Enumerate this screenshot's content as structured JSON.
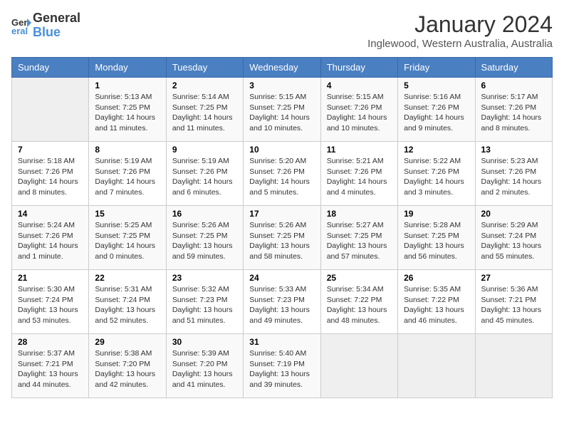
{
  "logo": {
    "line1": "General",
    "line2": "Blue"
  },
  "title": "January 2024",
  "location": "Inglewood, Western Australia, Australia",
  "days_of_week": [
    "Sunday",
    "Monday",
    "Tuesday",
    "Wednesday",
    "Thursday",
    "Friday",
    "Saturday"
  ],
  "weeks": [
    [
      {
        "day": "",
        "info": ""
      },
      {
        "day": "1",
        "info": "Sunrise: 5:13 AM\nSunset: 7:25 PM\nDaylight: 14 hours\nand 11 minutes."
      },
      {
        "day": "2",
        "info": "Sunrise: 5:14 AM\nSunset: 7:25 PM\nDaylight: 14 hours\nand 11 minutes."
      },
      {
        "day": "3",
        "info": "Sunrise: 5:15 AM\nSunset: 7:25 PM\nDaylight: 14 hours\nand 10 minutes."
      },
      {
        "day": "4",
        "info": "Sunrise: 5:15 AM\nSunset: 7:26 PM\nDaylight: 14 hours\nand 10 minutes."
      },
      {
        "day": "5",
        "info": "Sunrise: 5:16 AM\nSunset: 7:26 PM\nDaylight: 14 hours\nand 9 minutes."
      },
      {
        "day": "6",
        "info": "Sunrise: 5:17 AM\nSunset: 7:26 PM\nDaylight: 14 hours\nand 8 minutes."
      }
    ],
    [
      {
        "day": "7",
        "info": "Sunrise: 5:18 AM\nSunset: 7:26 PM\nDaylight: 14 hours\nand 8 minutes."
      },
      {
        "day": "8",
        "info": "Sunrise: 5:19 AM\nSunset: 7:26 PM\nDaylight: 14 hours\nand 7 minutes."
      },
      {
        "day": "9",
        "info": "Sunrise: 5:19 AM\nSunset: 7:26 PM\nDaylight: 14 hours\nand 6 minutes."
      },
      {
        "day": "10",
        "info": "Sunrise: 5:20 AM\nSunset: 7:26 PM\nDaylight: 14 hours\nand 5 minutes."
      },
      {
        "day": "11",
        "info": "Sunrise: 5:21 AM\nSunset: 7:26 PM\nDaylight: 14 hours\nand 4 minutes."
      },
      {
        "day": "12",
        "info": "Sunrise: 5:22 AM\nSunset: 7:26 PM\nDaylight: 14 hours\nand 3 minutes."
      },
      {
        "day": "13",
        "info": "Sunrise: 5:23 AM\nSunset: 7:26 PM\nDaylight: 14 hours\nand 2 minutes."
      }
    ],
    [
      {
        "day": "14",
        "info": "Sunrise: 5:24 AM\nSunset: 7:26 PM\nDaylight: 14 hours\nand 1 minute."
      },
      {
        "day": "15",
        "info": "Sunrise: 5:25 AM\nSunset: 7:25 PM\nDaylight: 14 hours\nand 0 minutes."
      },
      {
        "day": "16",
        "info": "Sunrise: 5:26 AM\nSunset: 7:25 PM\nDaylight: 13 hours\nand 59 minutes."
      },
      {
        "day": "17",
        "info": "Sunrise: 5:26 AM\nSunset: 7:25 PM\nDaylight: 13 hours\nand 58 minutes."
      },
      {
        "day": "18",
        "info": "Sunrise: 5:27 AM\nSunset: 7:25 PM\nDaylight: 13 hours\nand 57 minutes."
      },
      {
        "day": "19",
        "info": "Sunrise: 5:28 AM\nSunset: 7:25 PM\nDaylight: 13 hours\nand 56 minutes."
      },
      {
        "day": "20",
        "info": "Sunrise: 5:29 AM\nSunset: 7:24 PM\nDaylight: 13 hours\nand 55 minutes."
      }
    ],
    [
      {
        "day": "21",
        "info": "Sunrise: 5:30 AM\nSunset: 7:24 PM\nDaylight: 13 hours\nand 53 minutes."
      },
      {
        "day": "22",
        "info": "Sunrise: 5:31 AM\nSunset: 7:24 PM\nDaylight: 13 hours\nand 52 minutes."
      },
      {
        "day": "23",
        "info": "Sunrise: 5:32 AM\nSunset: 7:23 PM\nDaylight: 13 hours\nand 51 minutes."
      },
      {
        "day": "24",
        "info": "Sunrise: 5:33 AM\nSunset: 7:23 PM\nDaylight: 13 hours\nand 49 minutes."
      },
      {
        "day": "25",
        "info": "Sunrise: 5:34 AM\nSunset: 7:22 PM\nDaylight: 13 hours\nand 48 minutes."
      },
      {
        "day": "26",
        "info": "Sunrise: 5:35 AM\nSunset: 7:22 PM\nDaylight: 13 hours\nand 46 minutes."
      },
      {
        "day": "27",
        "info": "Sunrise: 5:36 AM\nSunset: 7:21 PM\nDaylight: 13 hours\nand 45 minutes."
      }
    ],
    [
      {
        "day": "28",
        "info": "Sunrise: 5:37 AM\nSunset: 7:21 PM\nDaylight: 13 hours\nand 44 minutes."
      },
      {
        "day": "29",
        "info": "Sunrise: 5:38 AM\nSunset: 7:20 PM\nDaylight: 13 hours\nand 42 minutes."
      },
      {
        "day": "30",
        "info": "Sunrise: 5:39 AM\nSunset: 7:20 PM\nDaylight: 13 hours\nand 41 minutes."
      },
      {
        "day": "31",
        "info": "Sunrise: 5:40 AM\nSunset: 7:19 PM\nDaylight: 13 hours\nand 39 minutes."
      },
      {
        "day": "",
        "info": ""
      },
      {
        "day": "",
        "info": ""
      },
      {
        "day": "",
        "info": ""
      }
    ]
  ]
}
